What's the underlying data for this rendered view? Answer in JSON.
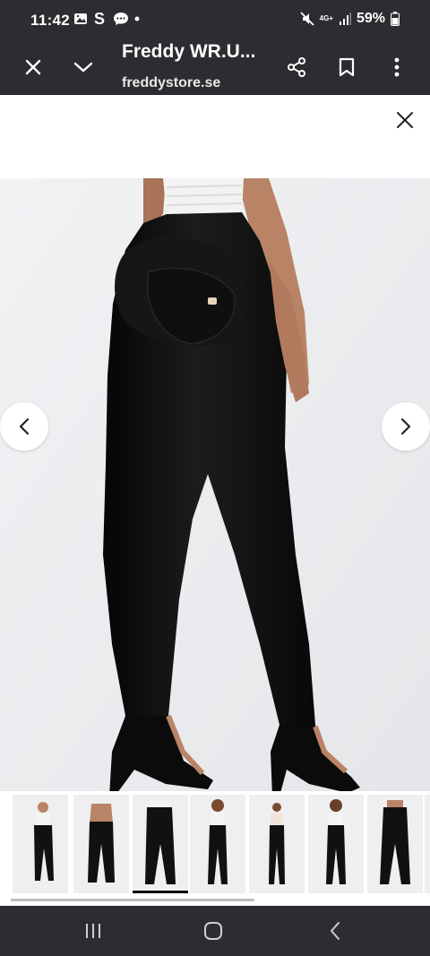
{
  "status_bar": {
    "time": "11:42",
    "battery": "59%",
    "network": "4G+"
  },
  "toolbar": {
    "title": "Freddy WR.U...",
    "domain": "freddystore.se"
  },
  "gallery": {
    "thumbnails": [
      {
        "label": "back view"
      },
      {
        "label": "front view"
      },
      {
        "label": "back view selected"
      },
      {
        "label": "front view white top"
      },
      {
        "label": "full body"
      },
      {
        "label": "full body white top"
      },
      {
        "label": "back view"
      }
    ],
    "selected_index": 2
  },
  "colors": {
    "chrome": "#2b2d30",
    "background": "#ffffff",
    "gallery_bg": "#eceef0",
    "pants": "#111111",
    "skin": "#b98466"
  }
}
